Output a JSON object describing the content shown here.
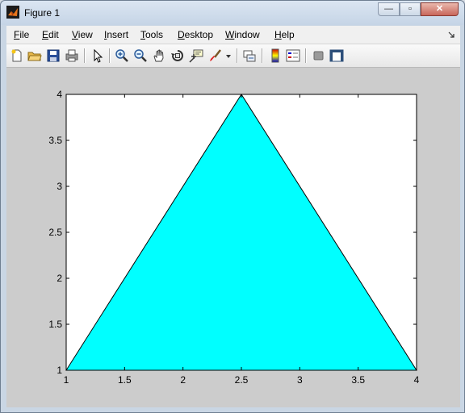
{
  "window": {
    "title": "Figure 1",
    "buttons": {
      "minimize": "—",
      "maximize": "▫",
      "close": "✕"
    }
  },
  "menu": {
    "items": [
      "File",
      "Edit",
      "View",
      "Insert",
      "Tools",
      "Desktop",
      "Window",
      "Help"
    ],
    "corner_icon": "dock-arrow-icon"
  },
  "toolbar": {
    "icons": [
      "new-figure-icon",
      "open-file-icon",
      "save-icon",
      "print-icon",
      "edit-plot-arrow-icon",
      "zoom-in-icon",
      "zoom-out-icon",
      "pan-hand-icon",
      "rotate-3d-icon",
      "data-cursor-icon",
      "brush-icon",
      "brush-dropdown-icon",
      "link-plot-icon",
      "colorbar-icon",
      "legend-icon",
      "hide-plot-tools-icon",
      "show-plot-tools-icon"
    ]
  },
  "colors": {
    "fill": "#00ffff",
    "figure_bg": "#cccccc",
    "axes_bg": "#ffffff"
  },
  "chart_data": {
    "type": "area",
    "series": [
      {
        "x": [
          1,
          2.5,
          4,
          1
        ],
        "y": [
          1,
          4,
          1,
          1
        ],
        "fill": "#00ffff",
        "edge": "#000000"
      }
    ],
    "xlim": [
      1,
      4
    ],
    "ylim": [
      1,
      4
    ],
    "xticks": [
      "1",
      "1.5",
      "2",
      "2.5",
      "3",
      "3.5",
      "4"
    ],
    "yticks": [
      "1",
      "1.5",
      "2",
      "2.5",
      "3",
      "3.5",
      "4"
    ],
    "grid": false
  }
}
